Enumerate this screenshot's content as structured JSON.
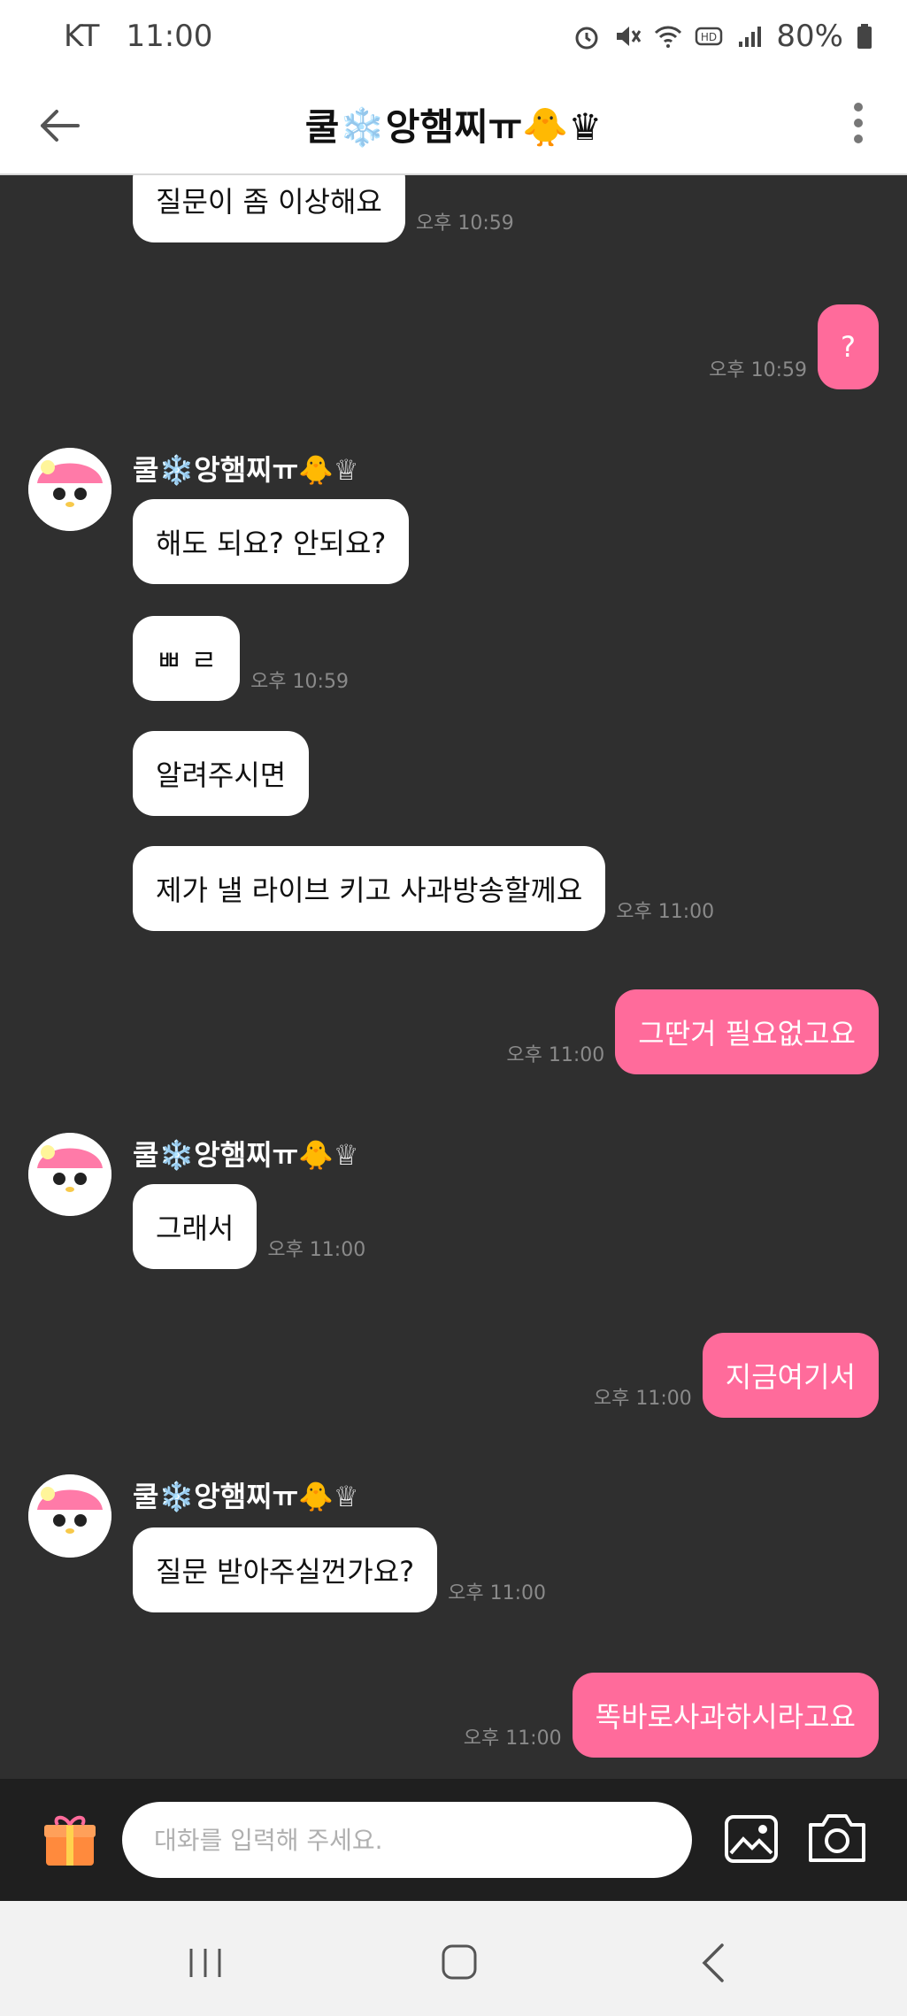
{
  "status": {
    "carrier": "KT",
    "time": "11:00",
    "battery": "80%",
    "icons": [
      "alarm-icon",
      "mute-icon",
      "wifi-icon",
      "hd-icon",
      "signal-icon",
      "battery-icon"
    ]
  },
  "header": {
    "title": "쿨❄️앙햄찌ㅠ🐥♛",
    "back_icon": "arrow-left-icon",
    "menu_icon": "kebab-menu-icon"
  },
  "messages": [
    {
      "side": "left",
      "text": "질문이 좀 이상해요",
      "time": "오후 10:59"
    },
    {
      "side": "right",
      "text": "?",
      "time": "오후 10:59"
    },
    {
      "side": "left",
      "sender": "쿨❄️앙햄찌ㅠ🐥♕",
      "text": "해도 되요? 안되요?",
      "time": ""
    },
    {
      "side": "left",
      "text": "ㅃ ㄹ",
      "time": "오후 10:59"
    },
    {
      "side": "left",
      "text": "알려주시면",
      "time": ""
    },
    {
      "side": "left",
      "text": "제가 낼 라이브 키고 사과방송할께요",
      "time": "오후 11:00"
    },
    {
      "side": "right",
      "text": "그딴거 필요없고요",
      "time": "오후 11:00"
    },
    {
      "side": "left",
      "sender": "쿨❄️앙햄찌ㅠ🐥♕",
      "text": "그래서",
      "time": "오후 11:00"
    },
    {
      "side": "right",
      "text": "지금여기서",
      "time": "오후 11:00"
    },
    {
      "side": "left",
      "sender": "쿨❄️앙햄찌ㅠ🐥♕",
      "text": "질문 받아주실껀가요?",
      "time": "오후 11:00"
    },
    {
      "side": "right",
      "text": "똑바로사과하시라고요",
      "time": "오후 11:00"
    }
  ],
  "input": {
    "placeholder": "대화를 입력해 주세요.",
    "gift_icon": "gift-icon",
    "gallery_icon": "image-icon",
    "camera_icon": "camera-icon"
  },
  "colors": {
    "background": "#2f2f2f",
    "my_bubble": "#ff6b9b",
    "their_bubble": "#ffffff",
    "input_bar": "#1f1f1f"
  }
}
